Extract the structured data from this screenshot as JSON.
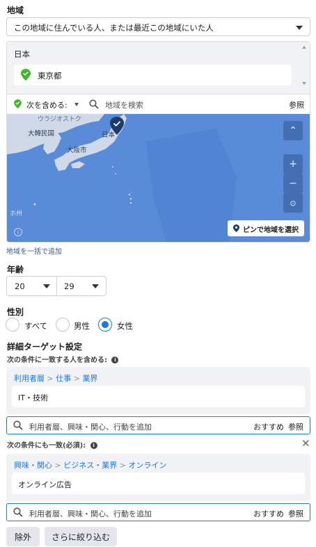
{
  "location": {
    "section_label": "地域",
    "audience_type": "この地域に住んでいる人、または最近この地域にいた人",
    "country": "日本",
    "selected_region": "東京都",
    "include_label": "次を含める:",
    "search_placeholder": "地域を検索",
    "browse_label": "参照",
    "map_labels": {
      "korea": "大韓民国",
      "japan": "日本",
      "osaka": "大阪市",
      "vladivostok": "ウラジオストク"
    },
    "pin_button": "ピンで地域を選択",
    "bulk_link": "地域を一括で追加"
  },
  "age": {
    "label": "年齢",
    "min": "20",
    "max": "29"
  },
  "gender": {
    "label": "性別",
    "options": [
      "すべて",
      "男性",
      "女性"
    ],
    "selected": "女性"
  },
  "detailed_targeting": {
    "title": "詳細ターゲット設定",
    "include_label": "次の条件に一致する人を含める:",
    "group1": {
      "breadcrumb": [
        "利用者層",
        "仕事",
        "業界"
      ],
      "item": "IT・技術"
    },
    "search_placeholder": "利用者層、興味・関心、行動を追加",
    "suggest_label": "おすすめ",
    "browse_label": "参照",
    "narrow_label": "次の条件にも一致(必須):",
    "group2": {
      "breadcrumb": [
        "興味・関心",
        "ビジネス・業界",
        "オンライン"
      ],
      "item": "オンライン広告"
    },
    "exclude_button": "除外",
    "narrow_more_button": "さらに絞り込む"
  },
  "colors": {
    "accent": "#1877f2",
    "green": "#42b72a",
    "map_sea": "#5a8bd8"
  }
}
